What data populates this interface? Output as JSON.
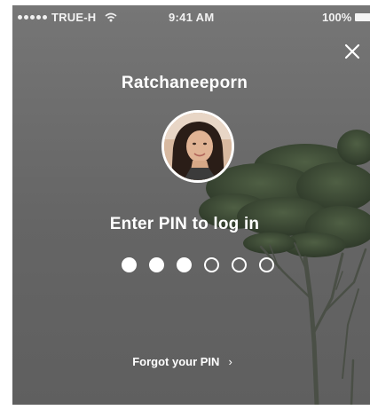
{
  "status_bar": {
    "signal_dots": 5,
    "carrier": "TRUE-H",
    "wifi_icon": "wifi-icon",
    "time": "9:41 AM",
    "battery": "100%"
  },
  "close_icon": "close-icon",
  "user": {
    "name": "Ratchaneeporn",
    "avatar_icon": "user-avatar"
  },
  "pin": {
    "prompt": "Enter PIN to log in",
    "length": 6,
    "entered": 3
  },
  "forgot": {
    "label": "Forgot your PIN",
    "chevron": "›"
  },
  "colors": {
    "background": "#6b6b6b",
    "text": "#ffffff"
  }
}
